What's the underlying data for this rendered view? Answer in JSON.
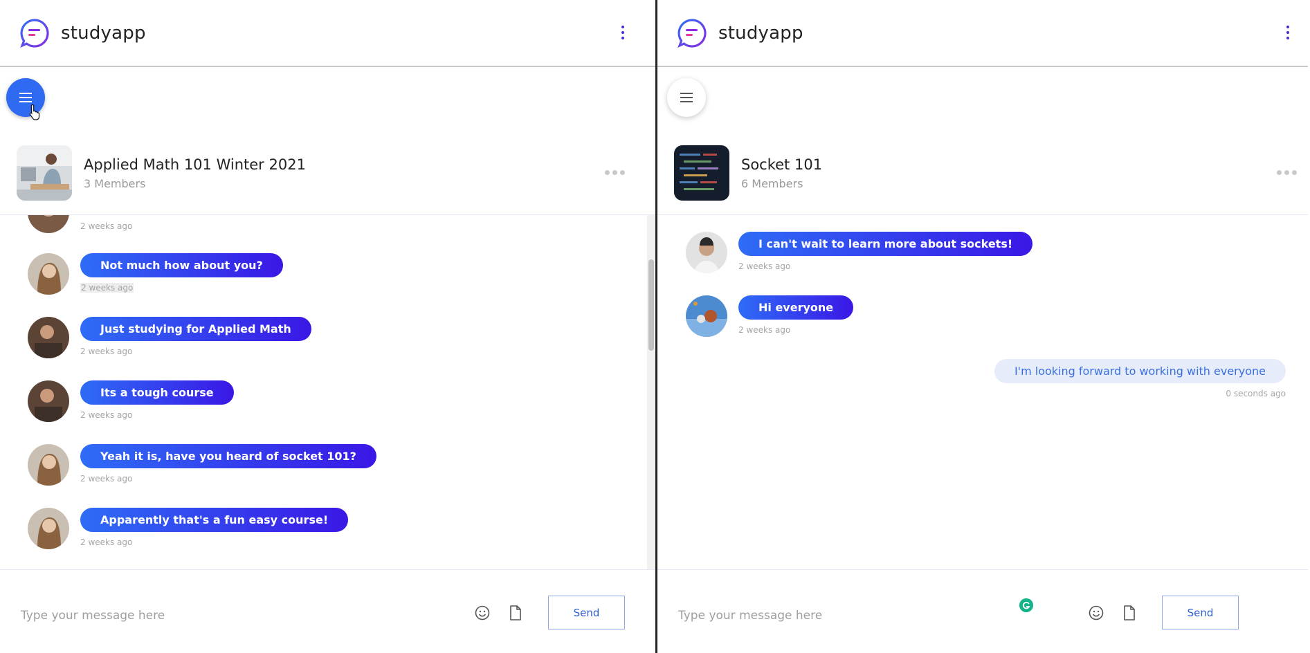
{
  "brand": {
    "name": "studyapp",
    "accent": "#4a2bd6",
    "logo_color_start": "#2e6cf6",
    "logo_color_end": "#8b2be2"
  },
  "panes": [
    {
      "group": {
        "name": "Applied Math 101 Winter 2021",
        "members": "3 Members"
      },
      "partial_time": "2 weeks ago",
      "messages": [
        {
          "text": "Not much how about you?",
          "time": "2 weeks ago"
        },
        {
          "text": "Just studying for Applied Math",
          "time": "2 weeks ago"
        },
        {
          "text": "Its a tough course",
          "time": "2 weeks ago"
        },
        {
          "text": "Yeah it is, have you heard of socket 101?",
          "time": "2 weeks ago"
        },
        {
          "text": "Apparently that's a fun easy course!",
          "time": "2 weeks ago"
        }
      ],
      "composer": {
        "placeholder": "Type your message here",
        "send_label": "Send"
      }
    },
    {
      "group": {
        "name": "Socket 101",
        "members": "6 Members"
      },
      "messages": [
        {
          "text": "I can't wait to learn more about sockets!",
          "time": "2 weeks ago"
        },
        {
          "text": "Hi everyone",
          "time": "2 weeks ago"
        }
      ],
      "own_message": {
        "text": "I'm looking forward to working with everyone",
        "time": "0 seconds ago"
      },
      "composer": {
        "placeholder": "Type your message here",
        "send_label": "Send"
      }
    }
  ],
  "icons": {
    "menu": "hamburger-icon",
    "more": "kebab-icon",
    "emoji": "smiley-icon",
    "attach": "file-icon"
  }
}
